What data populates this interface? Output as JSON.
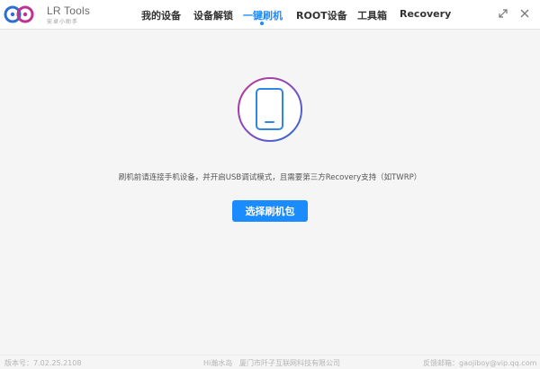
{
  "app": {
    "name": "LR Tools",
    "subtitle": "安卓小助手",
    "logo_colors": [
      "#2b6fd6",
      "#c2338f"
    ]
  },
  "nav": {
    "tabs": [
      {
        "label": "我的设备",
        "active": false
      },
      {
        "label": "设备解锁",
        "active": false
      },
      {
        "label": "一键刷机",
        "active": true
      },
      {
        "label": "ROOT设备",
        "active": false
      },
      {
        "label": "工具箱",
        "active": false
      },
      {
        "label": "Recovery",
        "active": false
      }
    ],
    "active_color": "#1a8cff"
  },
  "window_controls": {
    "icons": [
      "restore-icon",
      "close-icon"
    ]
  },
  "main": {
    "device_icon": "phone-icon",
    "ring_gradient": [
      "#2b6fd6",
      "#c2338f"
    ],
    "instruction": "刷机前请连接手机设备，并开启USB调试模式，且需要第三方Recovery支持（如TWRP）",
    "select_button": "选择刷机包",
    "button_color": "#1a8cff"
  },
  "status_bar": {
    "version": "版本号：7.02.25.2108",
    "slogan": "Hi瀚水岛",
    "company": "厦门市阡子互联网科技有限公司",
    "feedback": "反馈邮箱：gaojiboy@vip.qq.com"
  }
}
